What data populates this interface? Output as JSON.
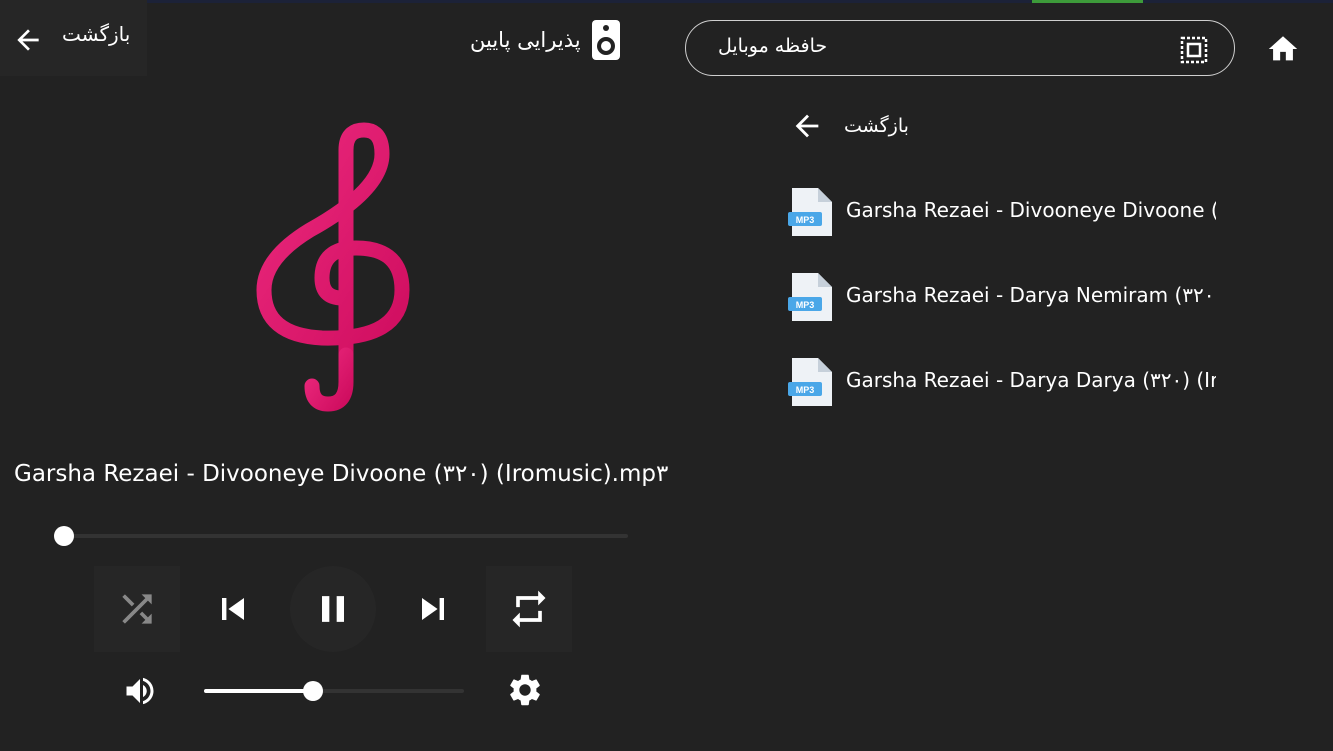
{
  "colors": {
    "background": "#222222",
    "accent_pink": "#e0126e",
    "text": "#ffffff",
    "muted": "#888888"
  },
  "header": {
    "back_label": "بازگشت",
    "output_label": "پذیرایی پایین",
    "storage_label": "حافظه موبایل",
    "icons": [
      "arrow-left-icon",
      "speaker-icon",
      "chip-icon",
      "home-icon"
    ]
  },
  "player": {
    "art_icon": "treble-clef-icon",
    "track_title": "Garsha Rezaei - Divooneye Divoone (۳۲۰) (Iromusic).mp۳",
    "progress_fraction": 0.01,
    "volume_fraction": 0.42,
    "shuffle_enabled": false,
    "state": "playing",
    "icons": [
      "shuffle-icon",
      "skip-previous-icon",
      "pause-icon",
      "skip-next-icon",
      "repeat-icon",
      "volume-icon",
      "settings-icon"
    ]
  },
  "browser": {
    "back_label": "بازگشت",
    "files": [
      {
        "name": "Garsha Rezaei - Divooneye Divoone (..",
        "icon": "mp3-file-icon",
        "badge": "MP3"
      },
      {
        "name": "Garsha Rezaei - Darya Nemiram (۳۲۰..",
        "icon": "mp3-file-icon",
        "badge": "MP3"
      },
      {
        "name": "Garsha Rezaei - Darya Darya (۳۲۰) (Ir..",
        "icon": "mp3-file-icon",
        "badge": "MP3"
      }
    ]
  }
}
